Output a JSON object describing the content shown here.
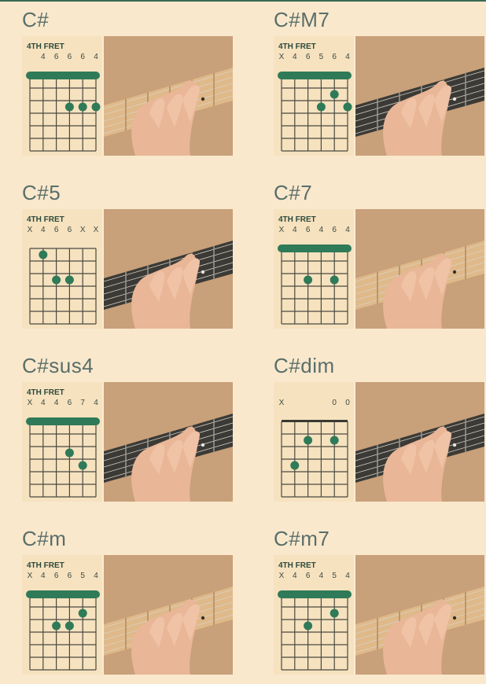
{
  "colors": {
    "background": "#f9e8cc",
    "dot": "#2f7a58",
    "grid": "#4a4a40",
    "panel": "#f6e2bf"
  },
  "chords": [
    {
      "name": "C#",
      "fret_label": "4TH FRET",
      "marks": [
        "",
        "4",
        "6",
        "6",
        "6",
        "4"
      ],
      "barre": true,
      "nut": false,
      "dots": [
        [
          3,
          3
        ],
        [
          4,
          3
        ],
        [
          5,
          3
        ]
      ]
    },
    {
      "name": "C#M7",
      "fret_label": "4TH FRET",
      "marks": [
        "X",
        "4",
        "6",
        "5",
        "6",
        "4"
      ],
      "barre": true,
      "nut": false,
      "dots": [
        [
          4,
          2
        ],
        [
          3,
          3
        ],
        [
          5,
          3
        ]
      ]
    },
    {
      "name": "C#5",
      "fret_label": "4TH FRET",
      "marks": [
        "X",
        "4",
        "6",
        "6",
        "X",
        "X"
      ],
      "barre": false,
      "nut": false,
      "dots": [
        [
          1,
          1
        ],
        [
          2,
          3
        ],
        [
          3,
          3
        ]
      ]
    },
    {
      "name": "C#7",
      "fret_label": "4TH FRET",
      "marks": [
        "X",
        "4",
        "6",
        "4",
        "6",
        "4"
      ],
      "barre": true,
      "nut": false,
      "dots": [
        [
          2,
          3
        ],
        [
          4,
          3
        ]
      ]
    },
    {
      "name": "C#sus4",
      "fret_label": "4TH FRET",
      "marks": [
        "X",
        "4",
        "4",
        "6",
        "7",
        "4"
      ],
      "barre": true,
      "nut": false,
      "dots": [
        [
          3,
          3
        ],
        [
          4,
          4
        ]
      ]
    },
    {
      "name": "C#dim",
      "fret_label": "",
      "marks": [
        "X",
        "",
        "",
        "",
        "0",
        "0"
      ],
      "barre": false,
      "nut": true,
      "dots": [
        [
          2,
          2
        ],
        [
          4,
          2
        ],
        [
          1,
          4
        ]
      ]
    },
    {
      "name": "C#m",
      "fret_label": "4TH FRET",
      "marks": [
        "X",
        "4",
        "6",
        "6",
        "5",
        "4"
      ],
      "barre": true,
      "nut": false,
      "dots": [
        [
          4,
          2
        ],
        [
          2,
          3
        ],
        [
          3,
          3
        ]
      ]
    },
    {
      "name": "C#m7",
      "fret_label": "4TH FRET",
      "marks": [
        "X",
        "4",
        "6",
        "4",
        "5",
        "4"
      ],
      "barre": true,
      "nut": false,
      "dots": [
        [
          4,
          2
        ],
        [
          2,
          3
        ]
      ]
    }
  ]
}
